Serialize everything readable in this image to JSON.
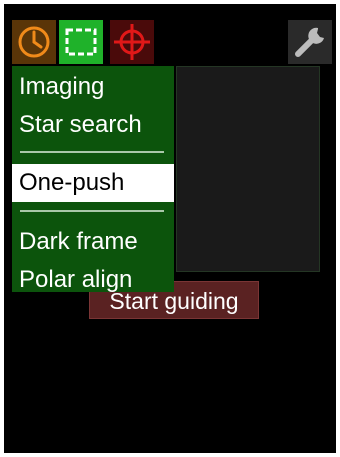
{
  "toolbar": {
    "buttons": [
      {
        "icon": "clock-icon",
        "active": false,
        "color": "#f08a1a"
      },
      {
        "icon": "frame-icon",
        "active": true,
        "color": "#1fb22a"
      },
      {
        "icon": "crosshair-icon",
        "active": false,
        "color": "#e01818"
      },
      {
        "icon": "wrench-icon",
        "active": false,
        "color": "#bcbcbc"
      }
    ]
  },
  "menu": {
    "items": [
      {
        "label": "Imaging",
        "selected": false
      },
      {
        "label": "Star search",
        "selected": false
      },
      {
        "label": "One-push",
        "selected": true
      },
      {
        "label": "Dark frame",
        "selected": false
      },
      {
        "label": "Polar align",
        "selected": false
      }
    ],
    "background": "#0c540c",
    "selected_background": "#ffffff"
  },
  "start_guiding": {
    "label": "Start guiding",
    "background": "#5a2222"
  },
  "theme": {
    "screen_background": "#000000"
  }
}
